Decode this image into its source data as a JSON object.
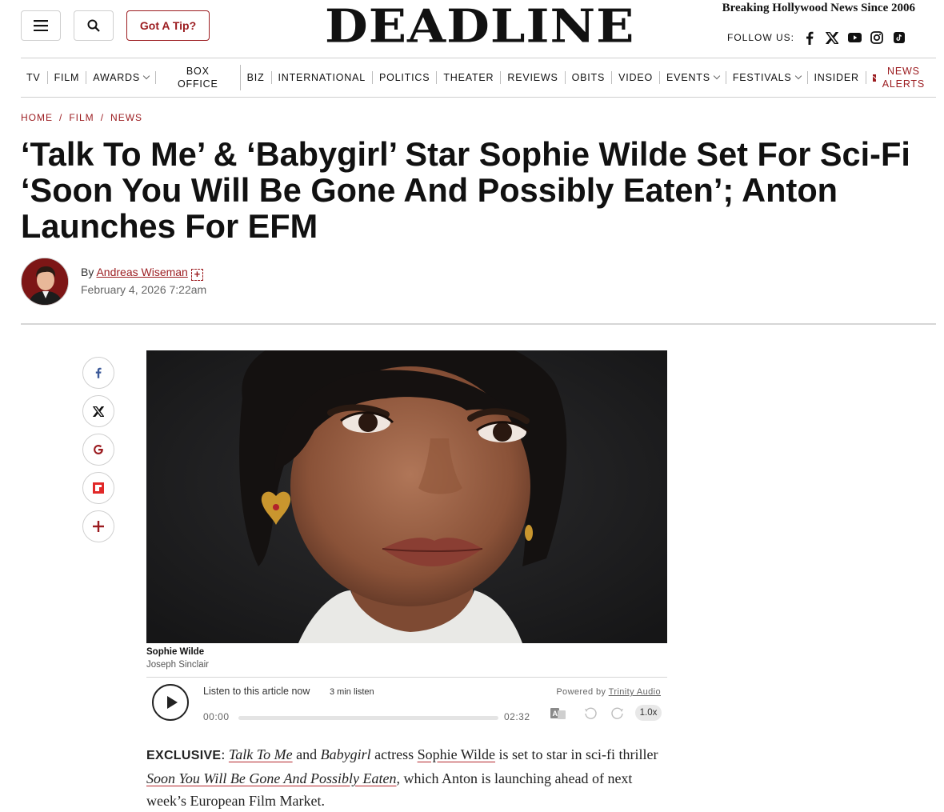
{
  "header": {
    "logo": "DEADLINE",
    "tagline": "Breaking Hollywood News Since 2006",
    "tip_button": "Got A Tip?",
    "follow_label": "FOLLOW US:",
    "socials": [
      "facebook-icon",
      "x-icon",
      "youtube-icon",
      "instagram-icon",
      "tiktok-icon"
    ]
  },
  "nav": {
    "items": [
      "TV",
      "FILM",
      "AWARDS",
      "BOX",
      "OFFICE",
      "BIZ",
      "INTERNATIONAL",
      "POLITICS",
      "THEATER",
      "REVIEWS",
      "OBITS",
      "VIDEO",
      "EVENTS",
      "FESTIVALS",
      "INSIDER"
    ],
    "alerts_line1": "NEWS",
    "alerts_line2": "ALERTS"
  },
  "breadcrumb": [
    "HOME",
    "FILM",
    "NEWS"
  ],
  "breadcrumb_sep": "/",
  "article": {
    "headline": "‘Talk To Me’ & ‘Babygirl’ Star Sophie Wilde Set For Sci-Fi ‘Soon You Will Be Gone And Possibly Eaten’; Anton Launches For EFM",
    "by": "By",
    "author": "Andreas Wiseman",
    "date": "February 4, 2026 7:22am",
    "caption": "Sophie Wilde",
    "credit": "Joseph Sinclair"
  },
  "audio": {
    "listen": "Listen to this article now",
    "mins": "3 min listen",
    "powered_by": "Powered by",
    "provider": "Trinity Audio",
    "current_time": "00:00",
    "duration": "02:32",
    "speed": "1.0x",
    "progress": 0
  },
  "body": {
    "lead": "EXCLUSIVE",
    "colon": ":",
    "film1": "Talk To Me",
    "and": "and",
    "film2": "Babygirl",
    "t1": "actress",
    "actor": "Sophie Wilde",
    "t2": "is set to star in sci-fi thriller",
    "film3": "Soon You Will Be Gone And Possibly Eaten",
    "t3": ", which Anton is launching ahead of next week’s European Film Market."
  },
  "colors": {
    "accent": "#9b1b1f",
    "text": "#111111",
    "rule": "#d6d6d6"
  }
}
